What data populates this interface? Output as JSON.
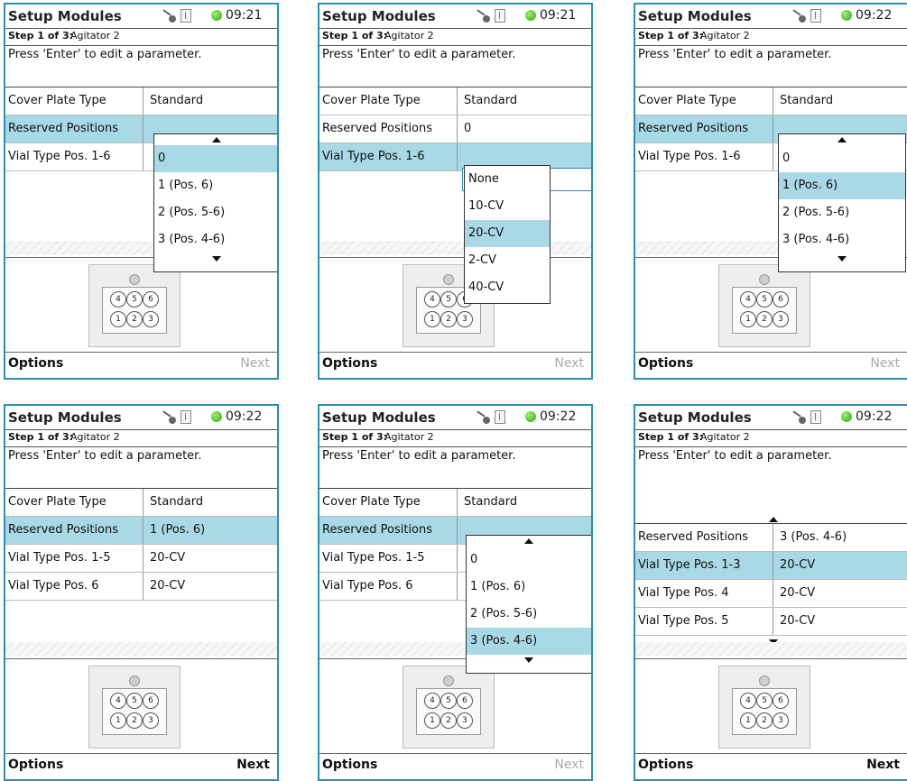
{
  "common": {
    "title": "Setup Modules",
    "step_label": "Step 1 of 3:",
    "agitator": "Agitator 2",
    "hint": "Press 'Enter' to edit a parameter.",
    "options": "Options",
    "next": "Next",
    "vials_top": [
      "4",
      "5",
      "6"
    ],
    "vials_bottom": [
      "1",
      "2",
      "3"
    ]
  },
  "panels": [
    {
      "time": "09:21",
      "rows": [
        {
          "label": "Cover Plate Type",
          "value": "Standard"
        },
        {
          "label": "Reserved Positions",
          "value": ""
        },
        {
          "label": "Vial Type Pos. 1-6",
          "value": ""
        }
      ],
      "dropdown": [
        "0",
        "1 (Pos. 6)",
        "2 (Pos. 5-6)",
        "3 (Pos. 4-6)"
      ]
    },
    {
      "time": "09:21",
      "rows": [
        {
          "label": "Cover Plate Type",
          "value": "Standard"
        },
        {
          "label": "Reserved Positions",
          "value": "0"
        },
        {
          "label": "Vial Type Pos. 1-6",
          "value": ""
        }
      ],
      "dropdown": [
        "None",
        "10-CV",
        "20-CV",
        "2-CV",
        "40-CV"
      ]
    },
    {
      "time": "09:22",
      "rows": [
        {
          "label": "Cover Plate Type",
          "value": "Standard"
        },
        {
          "label": "Reserved Positions",
          "value": ""
        },
        {
          "label": "Vial Type Pos. 1-6",
          "value": ""
        }
      ],
      "dropdown": [
        "0",
        "1 (Pos. 6)",
        "2 (Pos. 5-6)",
        "3 (Pos. 4-6)"
      ]
    },
    {
      "time": "09:22",
      "rows": [
        {
          "label": "Cover Plate Type",
          "value": "Standard"
        },
        {
          "label": "Reserved Positions",
          "value": "1 (Pos. 6)"
        },
        {
          "label": "Vial Type Pos. 1-5",
          "value": "20-CV"
        },
        {
          "label": "Vial Type Pos. 6",
          "value": "20-CV"
        }
      ]
    },
    {
      "time": "09:22",
      "rows": [
        {
          "label": "Cover Plate Type",
          "value": "Standard"
        },
        {
          "label": "Reserved Positions",
          "value": ""
        },
        {
          "label": "Vial Type Pos. 1-5",
          "value": ""
        },
        {
          "label": "Vial Type Pos. 6",
          "value": ""
        }
      ],
      "dropdown": [
        "0",
        "1 (Pos. 6)",
        "2 (Pos. 5-6)",
        "3 (Pos. 4-6)"
      ]
    },
    {
      "time": "09:22",
      "rows": [
        {
          "label": "Reserved Positions",
          "value": "3 (Pos. 4-6)"
        },
        {
          "label": "Vial Type Pos. 1-3",
          "value": "20-CV"
        },
        {
          "label": "Vial Type Pos. 4",
          "value": "20-CV"
        },
        {
          "label": "Vial Type Pos. 5",
          "value": "20-CV"
        }
      ]
    }
  ]
}
